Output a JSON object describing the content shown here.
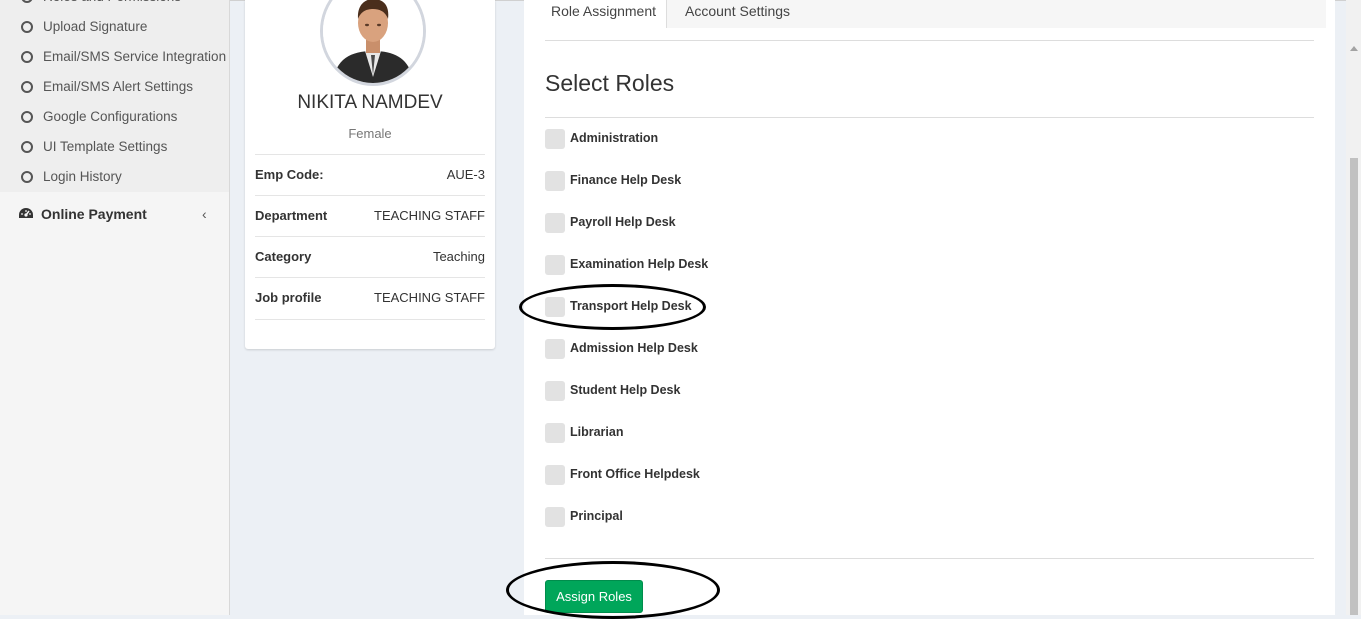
{
  "sidebar": {
    "items": [
      {
        "label": "Roles and Permissions"
      },
      {
        "label": "Upload Signature"
      },
      {
        "label": "Email/SMS Service Integration"
      },
      {
        "label": "Email/SMS Alert Settings"
      },
      {
        "label": "Google Configurations"
      },
      {
        "label": "UI Template Settings"
      },
      {
        "label": "Login History"
      }
    ],
    "online_payment": {
      "label": "Online Payment",
      "chevron": "‹",
      "icon": "dashboard-gauge-icon"
    }
  },
  "profile": {
    "name": "NIKITA NAMDEV",
    "gender": "Female",
    "rows": [
      {
        "key": "Emp Code:",
        "value": "AUE-3"
      },
      {
        "key": "Department",
        "value": "TEACHING STAFF"
      },
      {
        "key": "Category",
        "value": "Teaching"
      },
      {
        "key": "Job profile",
        "value": "TEACHING STAFF"
      }
    ]
  },
  "tabs": [
    {
      "label": "Role Assignment",
      "active": true
    },
    {
      "label": "Account Settings",
      "active": false
    }
  ],
  "roles_section": {
    "title": "Select Roles",
    "roles": [
      {
        "label": "Administration",
        "checked": false
      },
      {
        "label": "Finance Help Desk",
        "checked": false
      },
      {
        "label": "Payroll Help Desk",
        "checked": false
      },
      {
        "label": "Examination Help Desk",
        "checked": false
      },
      {
        "label": "Transport Help Desk",
        "checked": false
      },
      {
        "label": "Admission Help Desk",
        "checked": false
      },
      {
        "label": "Student Help Desk",
        "checked": false
      },
      {
        "label": "Librarian",
        "checked": false
      },
      {
        "label": "Front Office Helpdesk",
        "checked": false
      },
      {
        "label": "Principal",
        "checked": false
      }
    ],
    "assign_button_label": "Assign Roles"
  },
  "colors": {
    "accent_green": "#00a65a",
    "sidebar_bg": "#f5f5f5",
    "content_bg": "#ecf0f5"
  }
}
